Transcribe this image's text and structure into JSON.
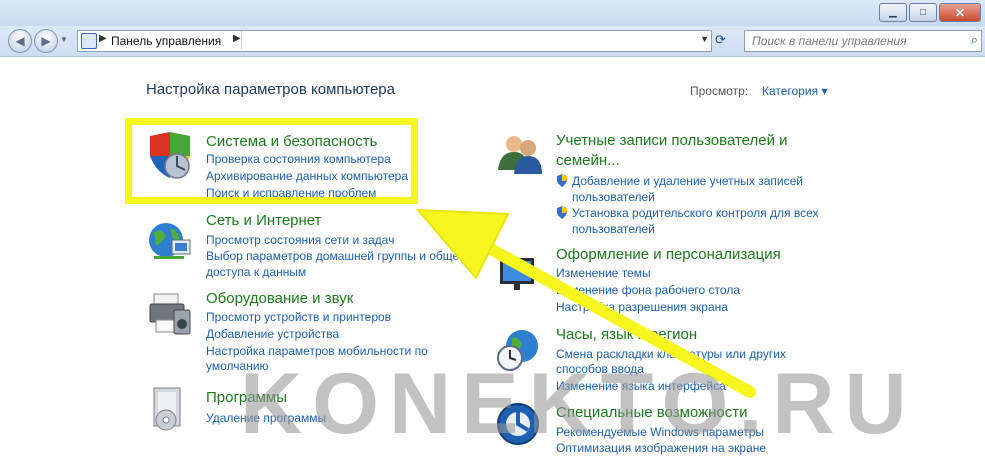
{
  "window": {
    "minimize": "▁",
    "maximize": "□",
    "close": "✕"
  },
  "nav": {
    "back": "◀",
    "forward": "▶",
    "breadcrumb": "Панель управления",
    "search_placeholder": "Поиск в панели управления"
  },
  "heading": "Настройка параметров компьютера",
  "view": {
    "label": "Просмотр:",
    "value": "Категория"
  },
  "categories_left": [
    {
      "title": "Система и безопасность",
      "links": [
        "Проверка состояния компьютера",
        "Архивирование данных компьютера",
        "Поиск и исправление проблем"
      ]
    },
    {
      "title": "Сеть и Интернет",
      "links": [
        "Просмотр состояния сети и задач",
        "Выбор параметров домашней группы и общего",
        "доступа к данным"
      ]
    },
    {
      "title": "Оборудование и звук",
      "links": [
        "Просмотр устройств и принтеров",
        "Добавление устройства",
        "Настройка параметров мобильности по",
        "умолчанию"
      ]
    },
    {
      "title": "Программы",
      "links": [
        "Удаление программы"
      ]
    }
  ],
  "categories_right": [
    {
      "title": "Учетные записи пользователей и",
      "title2": "семейн...",
      "links": [
        "Добавление и удаление учетных записей",
        "пользователей",
        "Установка родительского контроля для всех",
        "пользователей"
      ]
    },
    {
      "title": "Оформление и персонализация",
      "links": [
        "Изменение темы",
        "Изменение фона рабочего стола",
        "Настройка разрешения экрана"
      ]
    },
    {
      "title": "Часы, язык и регион",
      "links": [
        "Смена раскладки клавиатуры или других",
        "способов ввода",
        "Изменение языка интерфейса"
      ]
    },
    {
      "title": "Специальные возможности",
      "links": [
        "Рекомендуемые Windows параметры",
        "Оптимизация изображения на экране"
      ]
    }
  ],
  "watermark": "KONEKTO.RU",
  "colors": {
    "highlight": "#f6f51e",
    "title_green": "#1b7a1b",
    "link_blue": "#1a5fb4"
  }
}
